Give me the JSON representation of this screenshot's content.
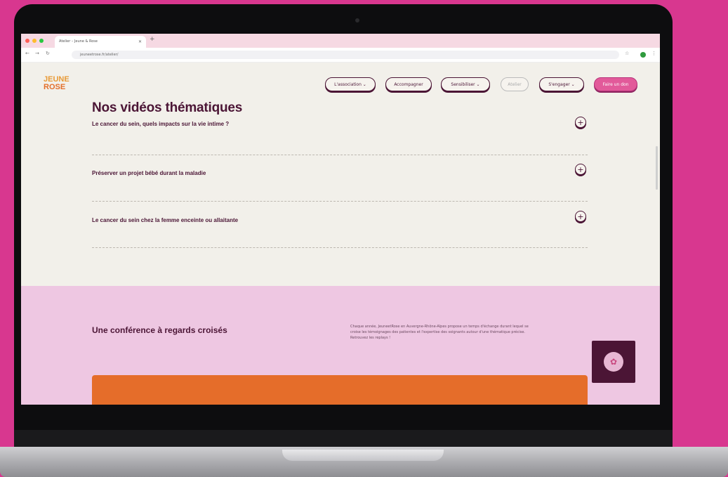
{
  "browser": {
    "tab_title": "Atelier – Jeune & Rose",
    "url": "jeuneetrose.fr/atelier/"
  },
  "site": {
    "logo_line1": "JEUNE",
    "logo_line2": "ROSE",
    "nav": [
      {
        "label": "L'association"
      },
      {
        "label": "Accompagner"
      },
      {
        "label": "Sensibiliser"
      },
      {
        "label": "Atelier"
      },
      {
        "label": "S'engager"
      }
    ],
    "cta": "Faire un don"
  },
  "videos": {
    "title": "Nos vidéos thématiques",
    "items": [
      {
        "label": "Le cancer du sein, quels impacts sur la vie intime ?"
      },
      {
        "label": "Préserver un projet bébé durant la maladie"
      },
      {
        "label": "Le cancer du sein chez la femme enceinte ou allaitante"
      }
    ]
  },
  "conference": {
    "title": "Une conférence à regards croisés",
    "text": "Chaque année, JeuneetRose en Auvergne-Rhône-Alpes propose un temps d'échange durant lequel se croise les témoignages des patientes et l'expertise des soignants autour d'une thématique précise. Retrouvez les replays !"
  },
  "colors": {
    "background": "#d8378f",
    "brand_dark": "#4b1535",
    "brand_pink": "#e25a9a",
    "section_pink": "#eec7e2",
    "accent_orange": "#e56d2a"
  }
}
